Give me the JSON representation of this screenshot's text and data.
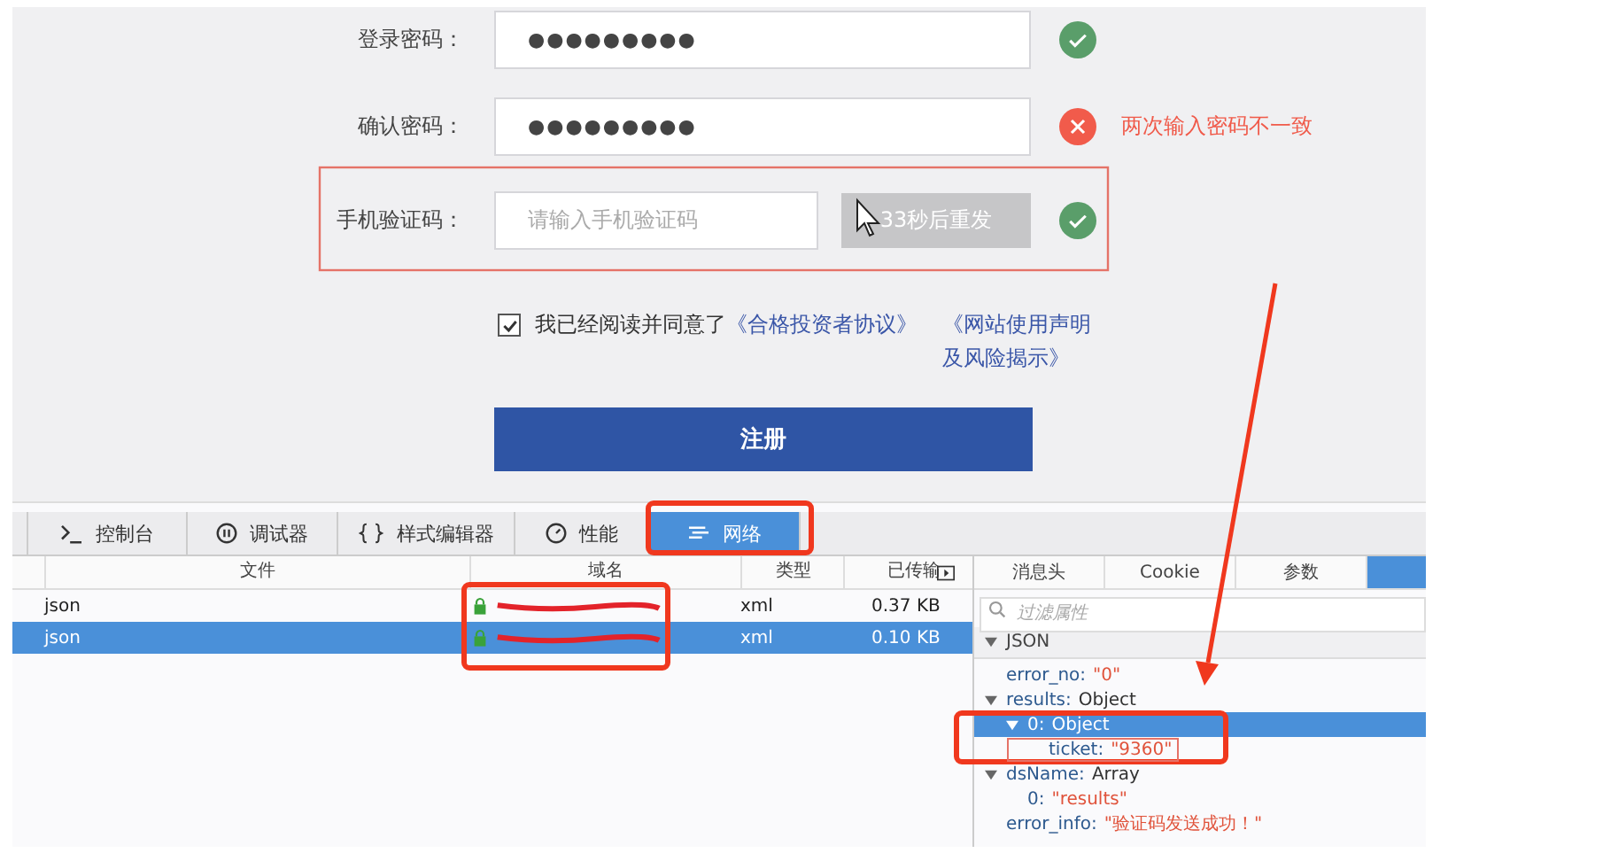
{
  "form": {
    "fields": [
      {
        "label": "登录密码：",
        "kind": "password",
        "value": "●●●●●●●●●",
        "valid": true
      },
      {
        "label": "确认密码：",
        "kind": "password",
        "value": "●●●●●●●●●",
        "valid": false,
        "message": "两次输入密码不一致"
      },
      {
        "label": "手机验证码：",
        "kind": "sms",
        "placeholder": "请输入手机验证码",
        "resend_button": {
          "label": "33秒后重发",
          "disabled": true
        },
        "valid": true
      }
    ],
    "agreement": {
      "checked": true,
      "text": "我已经阅读并同意了",
      "links": [
        "《合格投资者协议》",
        "《网站使用声明及风险揭示》"
      ]
    },
    "submit_button": "注册"
  },
  "devtools": {
    "tabs": [
      {
        "kind": "console",
        "label": "控制台",
        "selected": false
      },
      {
        "kind": "debugger",
        "label": "调试器",
        "selected": false
      },
      {
        "kind": "style",
        "label": "样式编辑器",
        "selected": false
      },
      {
        "kind": "performance",
        "label": "性能",
        "selected": false
      },
      {
        "kind": "network",
        "label": "网络",
        "selected": true
      }
    ],
    "requests": {
      "columns": [
        "文件",
        "域名",
        "类型",
        "已传输"
      ],
      "rows": [
        {
          "file": "json",
          "type": "xml",
          "size": "0.37 KB",
          "selected": false
        },
        {
          "file": "json",
          "type": "xml",
          "size": "0.10 KB",
          "selected": true
        }
      ]
    },
    "details": {
      "tabs": [
        {
          "label": "消息头",
          "selected": false
        },
        {
          "label": "Cookie",
          "selected": false
        },
        {
          "label": "参数",
          "selected": false
        },
        {
          "selected": true
        }
      ],
      "filter_placeholder": "过滤属性",
      "tree": [
        {
          "key": "JSON",
          "expanded": true,
          "selected": false,
          "kind": "section",
          "children": [
            {
              "key": "error_no:",
              "value": "\"0\"",
              "kind": "string",
              "selected": false
            },
            {
              "key": "results:",
              "value": "Object",
              "kind": "object",
              "expanded": true,
              "selected": false,
              "children": [
                {
                  "key": "0:",
                  "value": "Object",
                  "kind": "object",
                  "expanded": true,
                  "selected": true,
                  "children": [
                    {
                      "key": "ticket:",
                      "value": "\"9360\"",
                      "kind": "string",
                      "selected": false
                    }
                  ]
                }
              ]
            },
            {
              "key": "dsName:",
              "value": "Array",
              "kind": "object",
              "expanded": true,
              "selected": false,
              "children": [
                {
                  "key": "0:",
                  "value": "\"results\"",
                  "kind": "string",
                  "selected": false
                }
              ]
            },
            {
              "key": "error_info:",
              "value": "\"验证码发送成功！\"",
              "kind": "string",
              "selected": false
            }
          ]
        }
      ]
    }
  }
}
